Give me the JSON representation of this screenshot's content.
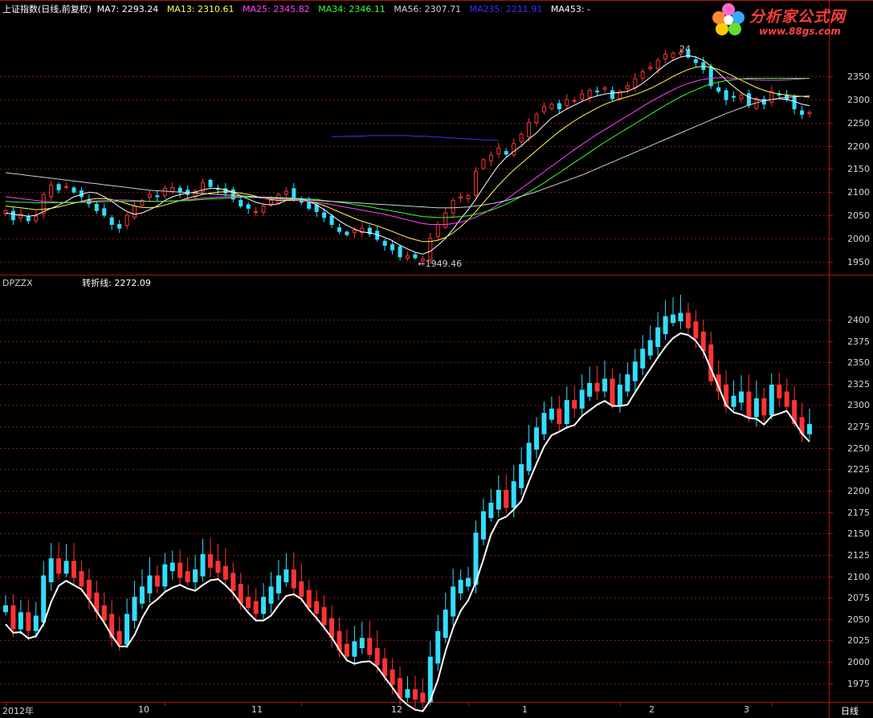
{
  "header": {
    "title": "上证指数(日线,前复权)",
    "ma": [
      {
        "label": "MA7: 2293.24",
        "color": "#ffffff"
      },
      {
        "label": "MA13: 2310.61",
        "color": "#ffff55"
      },
      {
        "label": "MA25: 2345.82",
        "color": "#ff44ff"
      },
      {
        "label": "MA34: 2346.11",
        "color": "#33ff33"
      },
      {
        "label": "MA56: 2307.71",
        "color": "#d0d0d0"
      },
      {
        "label": "MA235: 2211.91",
        "color": "#3333ff"
      },
      {
        "label": "MA453: -",
        "color": "#ffffff"
      }
    ]
  },
  "logo": {
    "brand": "分析家公式网",
    "url": "www.88gs.com"
  },
  "indicator": {
    "name": "DPZZX",
    "value_label": "转折线: 2272.09"
  },
  "annotations": {
    "low": "1949.46",
    "high": "24"
  },
  "footer": {
    "period": "日线",
    "dates": [
      "2012年",
      "10",
      "11",
      "12",
      "1",
      "2",
      "3"
    ]
  },
  "colors": {
    "up": "#ff3333",
    "down": "#33ddff",
    "grid": "#7a1a1a",
    "axis": "#b01010",
    "turn_line": "#ffffff"
  },
  "chart_data": [
    {
      "type": "candlestick",
      "title": "上证指数(日线,前复权)",
      "ylim": [
        1925,
        2425
      ],
      "y_ticks": [
        1950,
        2000,
        2050,
        2100,
        2150,
        2200,
        2250,
        2300,
        2350
      ],
      "x_date_ticks": [
        {
          "label": "2012年",
          "i": 0
        },
        {
          "label": "10",
          "i": 21
        },
        {
          "label": "11",
          "i": 39
        },
        {
          "label": "12",
          "i": 61
        },
        {
          "label": "1",
          "i": 81
        },
        {
          "label": "2",
          "i": 101
        },
        {
          "label": "3",
          "i": 116
        }
      ],
      "close": [
        2060,
        2040,
        2052,
        2038,
        2048,
        2095,
        2115,
        2105,
        2112,
        2100,
        2090,
        2075,
        2060,
        2050,
        2030,
        2022,
        2050,
        2070,
        2082,
        2095,
        2090,
        2108,
        2110,
        2100,
        2095,
        2102,
        2120,
        2112,
        2106,
        2098,
        2085,
        2070,
        2065,
        2058,
        2070,
        2082,
        2095,
        2102,
        2088,
        2078,
        2065,
        2058,
        2045,
        2030,
        2015,
        2008,
        2018,
        2022,
        2010,
        1998,
        1985,
        1975,
        1960,
        1962,
        1958,
        1955,
        2000,
        2030,
        2055,
        2082,
        2090,
        2092,
        2145,
        2170,
        2180,
        2195,
        2182,
        2205,
        2225,
        2250,
        2268,
        2285,
        2290,
        2280,
        2300,
        2298,
        2312,
        2320,
        2318,
        2325,
        2302,
        2318,
        2330,
        2345,
        2360,
        2370,
        2385,
        2398,
        2400,
        2402,
        2392,
        2380,
        2365,
        2330,
        2318,
        2300,
        2305,
        2310,
        2288,
        2302,
        2290,
        2318,
        2310,
        2300,
        2280,
        2268,
        2272
      ],
      "ma_series": [
        {
          "name": "MA7",
          "color": "#ffffff",
          "values": [
            2055,
            2052,
            2050,
            2048,
            2050,
            2058,
            2065,
            2072,
            2080,
            2090,
            2095,
            2100,
            2098,
            2090,
            2080,
            2068,
            2058,
            2052,
            2055,
            2062,
            2070,
            2082,
            2090,
            2095,
            2098,
            2100,
            2105,
            2108,
            2108,
            2105,
            2100,
            2092,
            2085,
            2078,
            2074,
            2072,
            2075,
            2082,
            2085,
            2085,
            2080,
            2072,
            2062,
            2050,
            2038,
            2028,
            2020,
            2014,
            2012,
            2008,
            2002,
            1995,
            1985,
            1977,
            1970,
            1966,
            1972,
            1985,
            2000,
            2020,
            2042,
            2062,
            2085,
            2110,
            2135,
            2158,
            2175,
            2188,
            2200,
            2215,
            2228,
            2245,
            2260,
            2270,
            2280,
            2288,
            2296,
            2303,
            2308,
            2312,
            2314,
            2315,
            2318,
            2325,
            2335,
            2348,
            2362,
            2375,
            2385,
            2392,
            2395,
            2392,
            2385,
            2372,
            2358,
            2342,
            2328,
            2315,
            2305,
            2300,
            2298,
            2300,
            2302,
            2300,
            2296,
            2290,
            2287
          ]
        },
        {
          "name": "MA13",
          "color": "#ffff55",
          "values": [
            2070,
            2068,
            2066,
            2064,
            2062,
            2063,
            2065,
            2068,
            2072,
            2076,
            2080,
            2084,
            2086,
            2086,
            2084,
            2080,
            2075,
            2070,
            2067,
            2066,
            2068,
            2072,
            2077,
            2082,
            2087,
            2091,
            2095,
            2098,
            2100,
            2101,
            2100,
            2098,
            2095,
            2091,
            2087,
            2084,
            2082,
            2082,
            2082,
            2082,
            2080,
            2076,
            2071,
            2064,
            2057,
            2050,
            2043,
            2037,
            2032,
            2027,
            2021,
            2015,
            2008,
            2002,
            1997,
            1993,
            1993,
            1996,
            2002,
            2012,
            2025,
            2040,
            2058,
            2077,
            2096,
            2115,
            2132,
            2148,
            2162,
            2176,
            2190,
            2204,
            2218,
            2231,
            2243,
            2254,
            2264,
            2273,
            2282,
            2290,
            2296,
            2301,
            2306,
            2311,
            2317,
            2324,
            2332,
            2341,
            2350,
            2358,
            2365,
            2370,
            2372,
            2370,
            2365,
            2358,
            2350,
            2342,
            2334,
            2326,
            2320,
            2315,
            2312,
            2310,
            2308,
            2307,
            2305
          ]
        },
        {
          "name": "MA25",
          "color": "#ff44ff",
          "values": [
            2090,
            2088,
            2086,
            2084,
            2082,
            2080,
            2079,
            2078,
            2078,
            2078,
            2079,
            2080,
            2081,
            2082,
            2083,
            2083,
            2083,
            2082,
            2081,
            2080,
            2080,
            2080,
            2081,
            2082,
            2084,
            2085,
            2087,
            2088,
            2089,
            2090,
            2090,
            2090,
            2089,
            2088,
            2087,
            2086,
            2085,
            2084,
            2083,
            2082,
            2080,
            2078,
            2076,
            2073,
            2070,
            2067,
            2064,
            2061,
            2058,
            2055,
            2052,
            2048,
            2044,
            2040,
            2036,
            2032,
            2030,
            2030,
            2030,
            2032,
            2035,
            2040,
            2046,
            2054,
            2063,
            2073,
            2084,
            2096,
            2108,
            2120,
            2132,
            2144,
            2156,
            2168,
            2180,
            2192,
            2203,
            2214,
            2225,
            2235,
            2245,
            2255,
            2265,
            2275,
            2285,
            2295,
            2304,
            2313,
            2321,
            2329,
            2335,
            2340,
            2344,
            2346,
            2347,
            2347,
            2346,
            2345,
            2344,
            2343,
            2342,
            2342,
            2342,
            2343,
            2344,
            2345,
            2346
          ]
        },
        {
          "name": "MA34",
          "color": "#33ff33",
          "values": [
            2080,
            2079,
            2078,
            2078,
            2077,
            2077,
            2077,
            2077,
            2077,
            2077,
            2078,
            2078,
            2079,
            2079,
            2080,
            2080,
            2080,
            2080,
            2080,
            2080,
            2080,
            2080,
            2081,
            2081,
            2082,
            2083,
            2084,
            2085,
            2086,
            2087,
            2088,
            2089,
            2089,
            2089,
            2089,
            2089,
            2088,
            2088,
            2087,
            2086,
            2085,
            2084,
            2082,
            2080,
            2078,
            2076,
            2073,
            2071,
            2068,
            2065,
            2062,
            2059,
            2056,
            2053,
            2050,
            2047,
            2046,
            2045,
            2045,
            2046,
            2047,
            2049,
            2052,
            2056,
            2061,
            2067,
            2074,
            2082,
            2091,
            2100,
            2110,
            2120,
            2131,
            2142,
            2153,
            2164,
            2175,
            2186,
            2197,
            2208,
            2218,
            2228,
            2238,
            2248,
            2258,
            2268,
            2278,
            2288,
            2297,
            2306,
            2314,
            2321,
            2328,
            2334,
            2338,
            2341,
            2343,
            2345,
            2346,
            2346,
            2346,
            2346,
            2346,
            2346,
            2346,
            2346,
            2346
          ]
        },
        {
          "name": "MA56",
          "color": "#d0d0d0",
          "values": [
            2142,
            2140,
            2138,
            2136,
            2134,
            2132,
            2130,
            2128,
            2126,
            2124,
            2122,
            2120,
            2118,
            2116,
            2114,
            2112,
            2110,
            2108,
            2106,
            2104,
            2103,
            2102,
            2101,
            2100,
            2099,
            2098,
            2097,
            2096,
            2095,
            2094,
            2093,
            2092,
            2091,
            2090,
            2089,
            2088,
            2087,
            2086,
            2085,
            2084,
            2083,
            2082,
            2081,
            2080,
            2079,
            2078,
            2077,
            2076,
            2075,
            2074,
            2073,
            2072,
            2071,
            2070,
            2069,
            2068,
            2067,
            2066,
            2066,
            2066,
            2067,
            2068,
            2070,
            2072,
            2075,
            2078,
            2082,
            2086,
            2091,
            2096,
            2101,
            2107,
            2113,
            2119,
            2125,
            2131,
            2137,
            2144,
            2151,
            2158,
            2165,
            2172,
            2179,
            2186,
            2193,
            2200,
            2207,
            2214,
            2221,
            2228,
            2235,
            2242,
            2249,
            2256,
            2263,
            2270,
            2276,
            2282,
            2288,
            2293,
            2297,
            2300,
            2303,
            2305,
            2306,
            2307,
            2308
          ]
        },
        {
          "name": "MA235",
          "color": "#3333ff",
          "values": [
            2220,
            2220,
            2221,
            2221,
            2221,
            2222,
            2222,
            2222,
            2222,
            2222,
            2222,
            2221,
            2221,
            2220,
            2219,
            2218,
            2217,
            2216,
            2215,
            2214,
            2213,
            2212,
            2212
          ]
        }
      ]
    },
    {
      "type": "candlestick",
      "title": "DPZZX",
      "ylim": [
        1955,
        2430
      ],
      "y_ticks": [
        1975,
        2000,
        2025,
        2050,
        2075,
        2100,
        2125,
        2150,
        2175,
        2200,
        2225,
        2250,
        2275,
        2300,
        2325,
        2350,
        2375,
        2400
      ],
      "turn_line_label": "转折线: 2272.09"
    }
  ]
}
